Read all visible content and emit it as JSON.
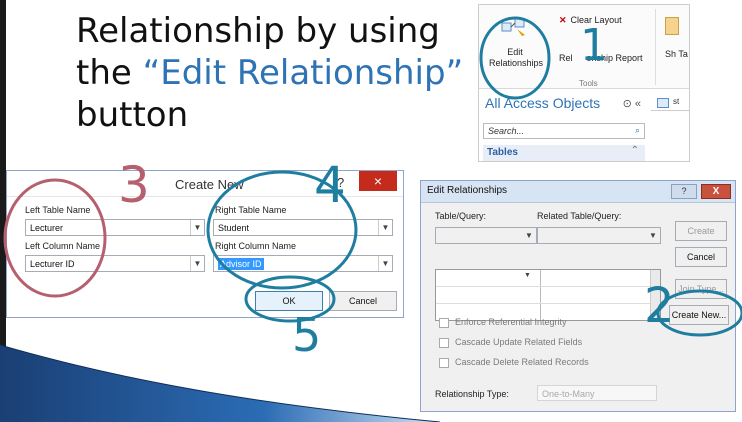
{
  "slide": {
    "title_line1": "Relationship by using",
    "title_pre": "the ",
    "title_highlight": "“Edit Relationship”",
    "title_line3": "button"
  },
  "ribbon": {
    "edit_relationships_label": "Edit Relationships",
    "clear_layout_label": "Clear Layout",
    "relationship_report_label_a": "Rel",
    "relationship_report_label_b": "onship Report",
    "tools_group_label": "Tools",
    "show_table_label": "Sh Ta",
    "nav_title": "All Access Objects",
    "search_placeholder": "Search...",
    "tables_header": "Tables",
    "tab_label": "st"
  },
  "create_new": {
    "title": "Create New",
    "help": "?",
    "close": "×",
    "left_table_label": "Left Table Name",
    "left_table_value": "Lecturer",
    "right_table_label": "Right Table Name",
    "right_table_value": "Student",
    "left_column_label": "Left Column Name",
    "left_column_value": "Lecturer ID",
    "right_column_label": "Right Column Name",
    "right_column_value": "Advisor ID",
    "ok_label": "OK",
    "cancel_label": "Cancel"
  },
  "edit_relationships": {
    "title": "Edit Relationships",
    "help": "?",
    "close": "X",
    "table_query_label": "Table/Query:",
    "related_table_label": "Related Table/Query:",
    "create_label": "Create",
    "cancel_label": "Cancel",
    "join_type_label": "Join Type...",
    "create_new_label": "Create New...",
    "enforce_label": "Enforce Referential Integrity",
    "cascade_update_label": "Cascade Update Related Fields",
    "cascade_delete_label": "Cascade Delete Related Records",
    "relationship_type_label": "Relationship Type:",
    "relationship_type_value": "One-to-Many"
  },
  "annotations": {
    "step1": "1",
    "step2": "2",
    "step3": "3",
    "step4": "4",
    "step5": "5"
  },
  "colors": {
    "highlight_text": "#2e74b5",
    "annotation_teal": "#1f7ea0",
    "annotation_rose": "#b5606e",
    "close_red": "#c42b1c",
    "slide_wedge": "#1f4e8c"
  },
  "icons": {
    "edit_relationships": "edit-relationships-icon",
    "clear_layout": "close-x-icon",
    "search": "magnifier-icon",
    "dropdown": "chevron-down-icon"
  }
}
